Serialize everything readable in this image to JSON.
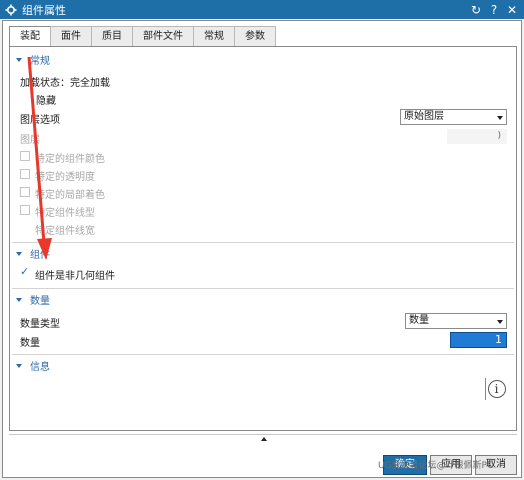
{
  "window": {
    "title": "组件属性",
    "controls": [
      "reset-icon",
      "help-icon",
      "close-icon"
    ]
  },
  "tabs": [
    "装配",
    "面件",
    "质目",
    "部件文件",
    "常规",
    "参数"
  ],
  "sections": {
    "general": {
      "label": "常规",
      "load_state_label": "加载状态：完全加载",
      "hidden_label": "隐藏",
      "layer_option_label": "图层选项",
      "layer_option_value": "原始图层",
      "layer_label": "图层",
      "layer_value": ")",
      "checkboxes": [
        "特定的组件颜色",
        "特定的透明度",
        "特定的局部着色",
        "特定组件线型",
        "特定组件线宽"
      ]
    },
    "component": {
      "label": "组件",
      "nongeom_label": "组件是非几何组件"
    },
    "quantity": {
      "label": "数量",
      "type_label": "数量类型",
      "type_value": "数量",
      "qty_label": "数量",
      "qty_value": "1"
    },
    "info": {
      "label": "信息"
    }
  },
  "footer": {
    "ok_label": "确定",
    "apply_label": "应用",
    "cancel_label": "取消",
    "watermark": "UG爱好者论坛@叶根佩斯PC"
  },
  "colors": {
    "titlebar": "#1e6fa8",
    "accent": "#2d6aa7",
    "annotation_arrow": "#e8382b",
    "quantity_highlight": "#1f7bd3"
  }
}
